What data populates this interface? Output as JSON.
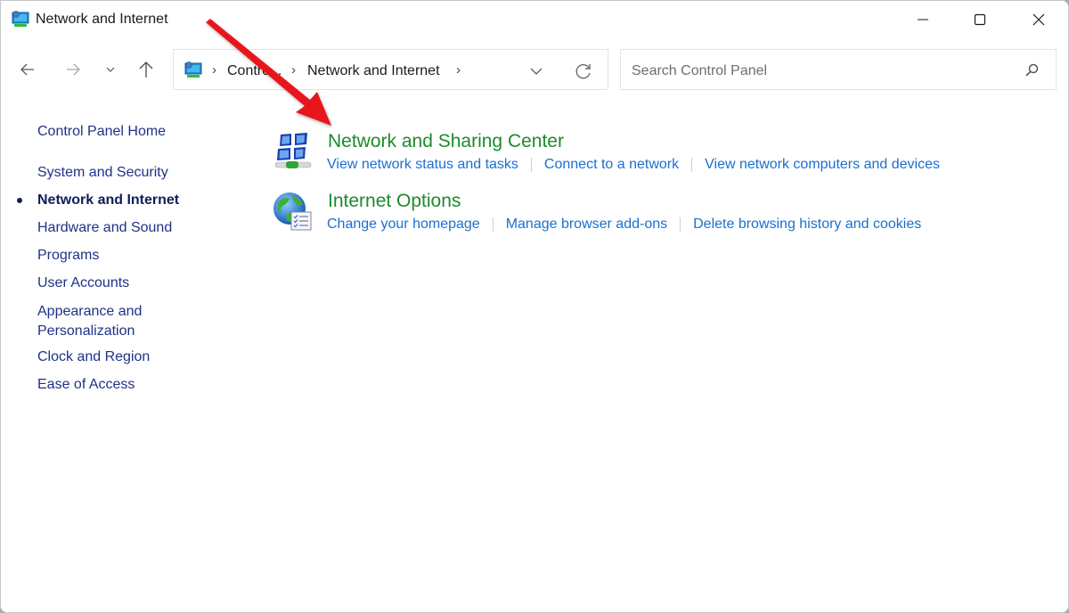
{
  "window": {
    "title": "Network and Internet",
    "title_icon": "control-panel-network-icon",
    "controls": {
      "minimize_icon": "minimize-icon",
      "maximize_icon": "maximize-icon",
      "close_icon": "close-icon"
    }
  },
  "navigation": {
    "back_icon": "arrow-left-icon",
    "forward_icon": "arrow-right-icon",
    "recent_icon": "chevron-down-icon",
    "up_icon": "arrow-up-icon"
  },
  "address_bar": {
    "breadcrumbs": [
      {
        "label": "Contro..."
      },
      {
        "label": "Network and Internet"
      }
    ],
    "separator": "›",
    "dropdown_icon": "chevron-down-icon",
    "refresh_icon": "refresh-icon"
  },
  "search": {
    "placeholder": "Search Control Panel",
    "value": "",
    "icon": "search-icon"
  },
  "sidebar": {
    "items": [
      {
        "label": "Control Panel Home",
        "active": false
      },
      {
        "label": "System and Security",
        "active": false
      },
      {
        "label": "Network and Internet",
        "active": true
      },
      {
        "label": "Hardware and Sound",
        "active": false
      },
      {
        "label": "Programs",
        "active": false
      },
      {
        "label": "User Accounts",
        "active": false
      },
      {
        "label": "Appearance and Personalization",
        "line1": "Appearance and",
        "line2": "Personalization",
        "active": false
      },
      {
        "label": "Clock and Region",
        "active": false
      },
      {
        "label": "Ease of Access",
        "active": false
      }
    ]
  },
  "categories": [
    {
      "title": "Network and Sharing Center",
      "icon": "network-sharing-center-icon",
      "links": [
        "View network status and tasks",
        "Connect to a network",
        "View network computers and devices"
      ]
    },
    {
      "title": "Internet Options",
      "icon": "internet-options-globe-icon",
      "links": [
        "Change your homepage",
        "Manage browser add-ons",
        "Delete browsing history and cookies"
      ]
    }
  ],
  "annotation": {
    "type": "arrow",
    "color": "#e8141c",
    "points_to": "Network and Sharing Center"
  },
  "colors": {
    "category_title": "#1e8a2c",
    "link": "#1a6fd0",
    "sidebar_link": "#1e3287"
  }
}
